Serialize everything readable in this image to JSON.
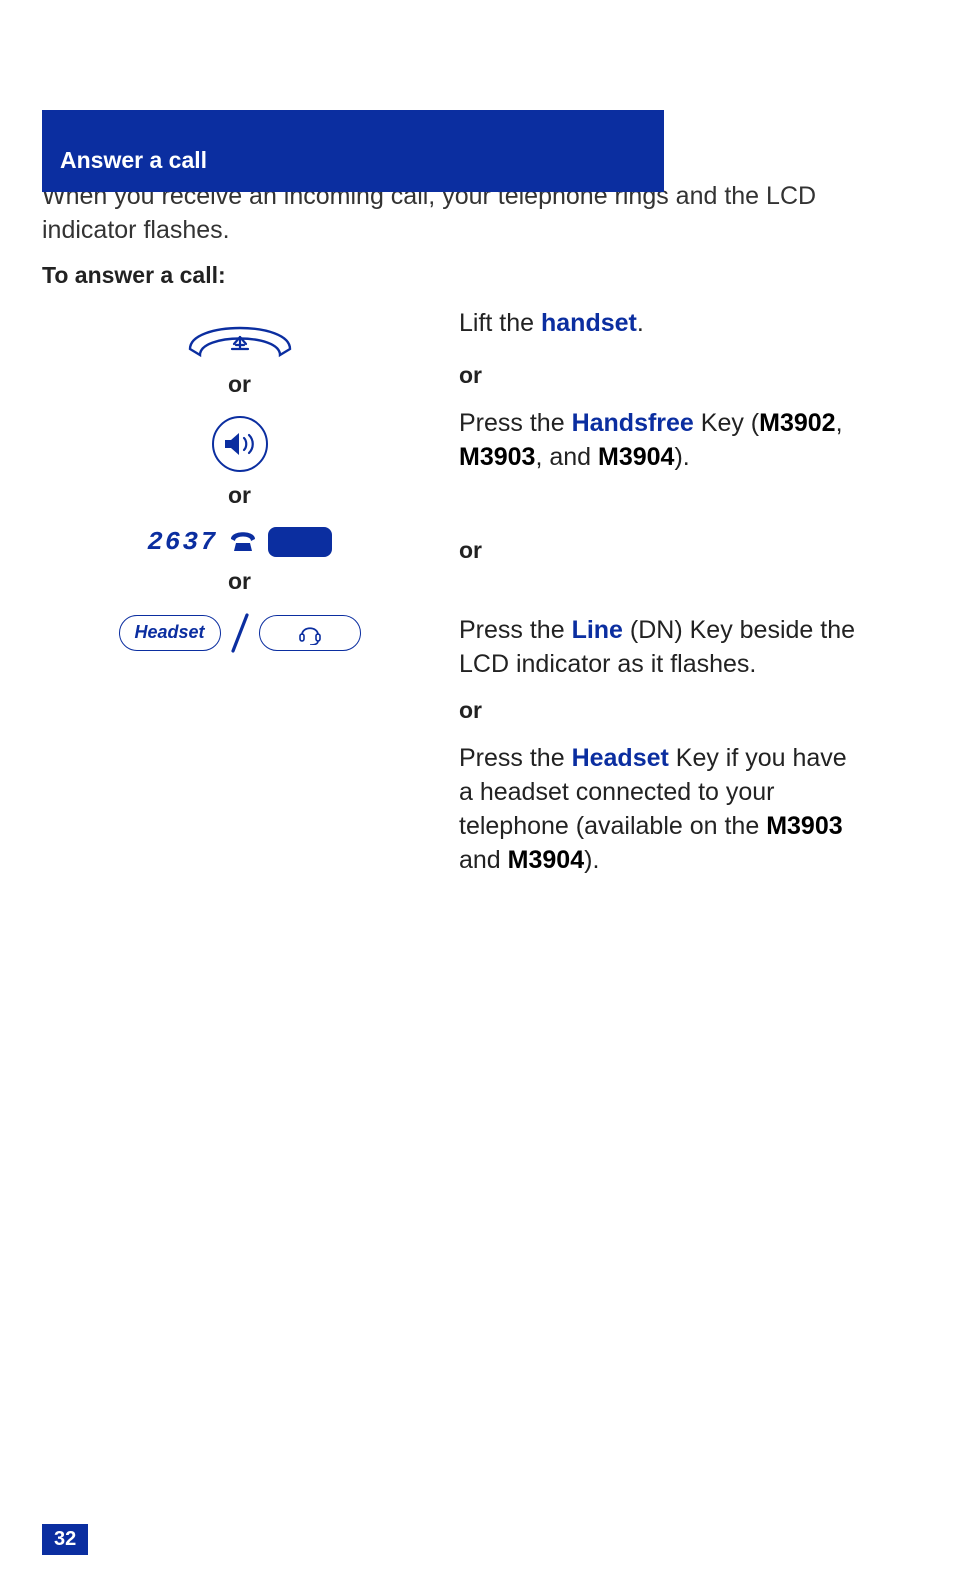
{
  "header": {
    "tab": "Answer a call"
  },
  "title": "Answer a call",
  "intro": "When you receive an incoming call, your telephone rings and the LCD indicator flashes.",
  "lead": "To answer a call:",
  "left": {
    "or1": "or",
    "or2": "or",
    "dn_number": "2637",
    "or3": "or",
    "headset_label": "Headset"
  },
  "right": {
    "step1_pre": "Lift the ",
    "step1_kw": "handset",
    "step1_post": ".",
    "or1": "or",
    "step2_pre": "Press the ",
    "step2_kw": "Handsfree",
    "step2_mid": " Key (",
    "step2_m1": "M3902",
    "step2_c1": ", ",
    "step2_m2": "M3903",
    "step2_c2": ", and ",
    "step2_m3": "M3904",
    "step2_post": ").",
    "or2": "or",
    "step3_pre": "Press the ",
    "step3_kw": "Line",
    "step3_post": " (DN) Key beside the LCD indicator as it flashes.",
    "or3": "or",
    "step4_pre": "Press the ",
    "step4_kw": "Headset",
    "step4_mid": " Key if you have a headset connected to your telephone (available on the ",
    "step4_m1": "M3903",
    "step4_c1": " and ",
    "step4_m2": "M3904",
    "step4_post": ")."
  },
  "page_number": "32"
}
